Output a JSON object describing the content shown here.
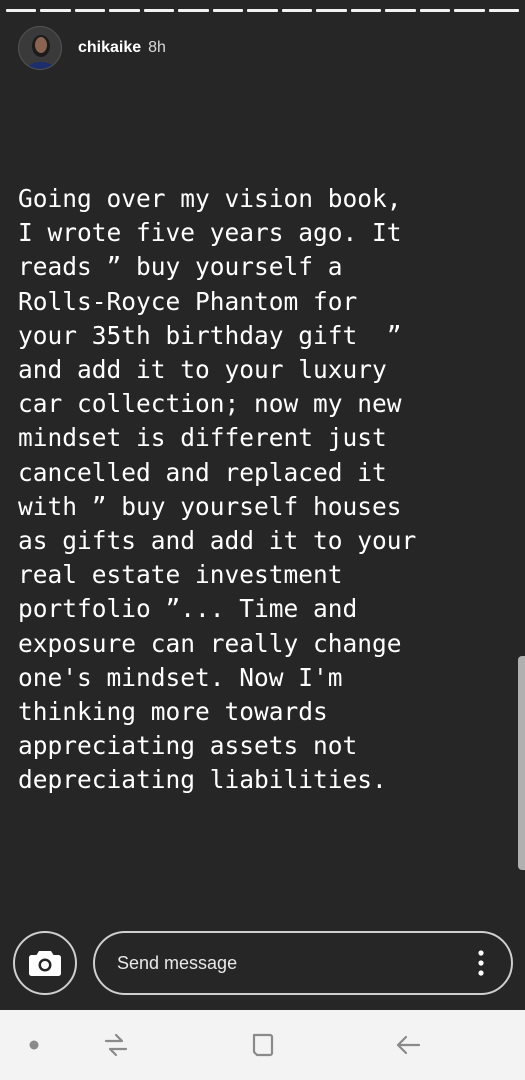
{
  "story": {
    "progress": {
      "segments": 15,
      "current": 15
    },
    "user": {
      "username": "chikaike",
      "time_ago": "8h"
    },
    "text_lines": [
      "Going over my vision book,",
      "I wrote five years ago. It",
      "reads ” buy yourself a",
      "Rolls-Royce Phantom for",
      "your 35th birthday gift  ”",
      "and add it to your luxury",
      "car collection; now my new",
      "mindset is different just",
      "cancelled and replaced it",
      "with ” buy yourself houses",
      "as gifts and add it to your",
      "real estate investment",
      "portfolio ”... Time and",
      "exposure can really change",
      "one's mindset. Now I'm",
      "thinking more towards",
      "appreciating assets not",
      "depreciating liabilities."
    ]
  },
  "reply_bar": {
    "camera_icon": "camera-icon",
    "message_placeholder": "Send message",
    "more_icon": "more-vertical-icon"
  },
  "navbar": {
    "icons": [
      "dot-icon",
      "recent-apps-icon",
      "home-icon",
      "back-icon"
    ]
  },
  "colors": {
    "background": "#262626",
    "text": "#ffffff",
    "navbar": "#f3f3f3",
    "nav_icon": "#8a8a8a"
  }
}
